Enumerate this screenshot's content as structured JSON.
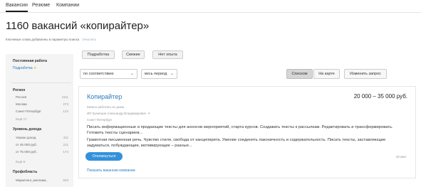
{
  "nav": {
    "tabs": [
      {
        "label": "Вакансии",
        "active": true
      },
      {
        "label": "Резюме",
        "active": false
      },
      {
        "label": "Компании",
        "active": false
      }
    ]
  },
  "page": {
    "title": "1160 вакансий «копирайтер»",
    "keywords_note": "Ключевые слова добавлены в параметры поиска",
    "clear_link": "Очистить"
  },
  "sidebar": {
    "permanent": {
      "title": "Постоянная работа",
      "link": "Подработка"
    },
    "region": {
      "title": "Регион",
      "items": [
        {
          "label": "Россия",
          "count": "1111"
        },
        {
          "label": "Москва",
          "count": "273"
        },
        {
          "label": "Санкт-Петербург",
          "count": "122"
        }
      ],
      "more": "Ещё 17"
    },
    "income": {
      "title": "Уровень дохода",
      "items": [
        {
          "label": "Указан доход",
          "count": "411"
        },
        {
          "label": "от 45 000 руб.",
          "count": "211"
        },
        {
          "label": "от 75 000 руб.",
          "count": "174"
        }
      ],
      "more": "Ещё 5"
    },
    "profession": {
      "title": "Профобласть",
      "items": [
        {
          "label": "Маркетинг, реклама,",
          "count": "843"
        }
      ]
    }
  },
  "filters": {
    "chips": [
      "Подработка",
      "Свежие",
      "Нет опыта"
    ],
    "sort_select": "по соответствию",
    "period_select": "весь период",
    "view_list": "Списком",
    "view_map": "На карте",
    "change_query": "Изменить запрос"
  },
  "vacancy": {
    "title": "Копирайтер",
    "salary": "20 000 – 35 000 руб.",
    "remote": "Можно работать из дома",
    "employer": "ИП Кузнецов Александр Владимирович",
    "city": "Санкт-Петербург",
    "description": "Писать информационные и продающие тексты для анонсов мероприятий, старта курсов. Создавать тексты к рассылкам. Редактировать и трансформировать. Готовить тексты сценариев...",
    "requirements": "Грамотная письменная речь. Чувство стиля, свобода от канцелярита. Умение соединять лаконичность и содержательность. Писать тексты, заставляющие задуматься, побуждающие, мотивирующие – разные...",
    "respond_label": "Откликнуться",
    "date": "29 мая",
    "show_company_link": "Показать вакансии компании"
  }
}
